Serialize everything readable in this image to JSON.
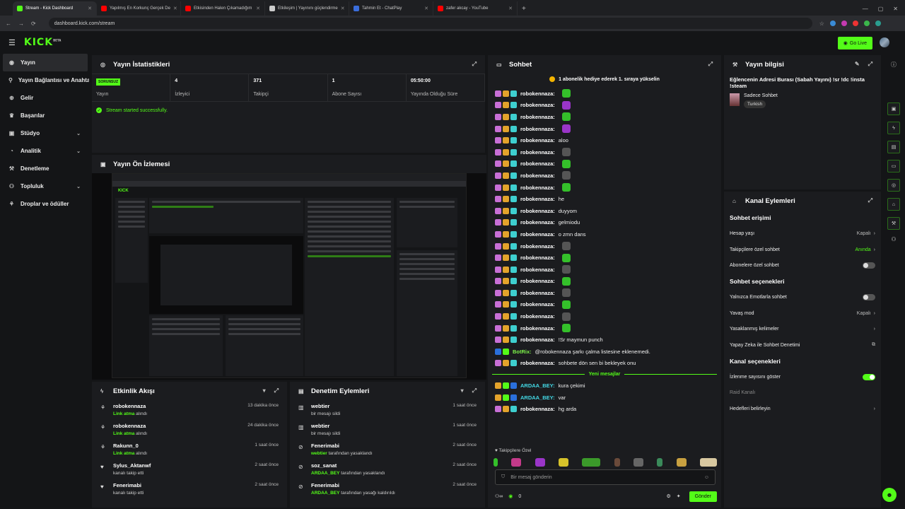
{
  "browser": {
    "tabs": [
      {
        "label": "Stream - Kick Dashboard",
        "color": "#53fc18"
      },
      {
        "label": "Yapılmış En Korkunç Gerçek De",
        "color": "#ff0000"
      },
      {
        "label": "Etkisinden Halen Çıkamadığım",
        "color": "#ff0000"
      },
      {
        "label": "Etkileşim | Yayınını güçlendirme",
        "color": "#cccccc"
      },
      {
        "label": "Tahmin Et - ChatPlay",
        "color": "#3a6ddb"
      },
      {
        "label": "zafer akcay - YouTube",
        "color": "#ff0000"
      }
    ],
    "url": "dashboard.kick.com/stream"
  },
  "header": {
    "logo": "KICK",
    "logo_sup": "BETA",
    "go_live": "Go Live"
  },
  "sidebar": {
    "items": [
      {
        "label": "Yayın",
        "icon": "broadcast-icon"
      },
      {
        "label": "Yayın Bağlantısı ve Anahtarı",
        "icon": "key-icon"
      },
      {
        "label": "Gelir",
        "icon": "money-icon"
      },
      {
        "label": "Başarılar",
        "icon": "trophy-icon"
      },
      {
        "label": "Stüdyo",
        "icon": "studio-icon"
      },
      {
        "label": "Analitik",
        "icon": "analytics-icon"
      },
      {
        "label": "Denetleme",
        "icon": "wrench-icon"
      },
      {
        "label": "Topluluk",
        "icon": "community-icon"
      },
      {
        "label": "Droplar ve ödüller",
        "icon": "gift-icon"
      }
    ]
  },
  "stats": {
    "title": "Yayın İstatistikleri",
    "badge": "SORUNSUZ",
    "items": [
      {
        "value": "",
        "label": "Yayın"
      },
      {
        "value": "4",
        "label": "İzleyici"
      },
      {
        "value": "371",
        "label": "Takipçi"
      },
      {
        "value": "1",
        "label": "Abone Sayısı"
      },
      {
        "value": "05:50:00",
        "label": "Yayında Olduğu Süre"
      }
    ],
    "success": "Stream started successfully."
  },
  "preview": {
    "title": "Yayın Ön İzlemesi"
  },
  "feed": {
    "title": "Etkinlik Akışı",
    "items": [
      {
        "name": "robokennaza",
        "hl": "Link atma",
        "rest": " alındı",
        "time": "13 dakika önce",
        "icon": "gift-icon"
      },
      {
        "name": "robokennaza",
        "hl": "Link atma",
        "rest": " alındı",
        "time": "24 dakika önce",
        "icon": "gift-icon"
      },
      {
        "name": "Rakunn_0",
        "hl": "Link atma",
        "rest": " alındı",
        "time": "1 saat önce",
        "icon": "gift-icon"
      },
      {
        "name": "Sylus_Aktanwf",
        "hl": "",
        "rest": "kanalı takip etti",
        "time": "2 saat önce",
        "icon": "heart-icon"
      },
      {
        "name": "Fenerimabi",
        "hl": "",
        "rest": "kanalı takip etti",
        "time": "2 saat önce",
        "icon": "heart-icon"
      }
    ]
  },
  "mod": {
    "title": "Denetim Eylemleri",
    "items": [
      {
        "name": "webtier",
        "hl": "",
        "rest": "bir mesajı sildi",
        "time": "1 saat önce",
        "icon": "trash-icon"
      },
      {
        "name": "webtier",
        "hl": "",
        "rest": "bir mesajı sildi",
        "time": "1 saat önce",
        "icon": "trash-icon"
      },
      {
        "name": "Fenerimabi",
        "hl": "webtier",
        "rest": " tarafından yasaklandı",
        "time": "2 saat önce",
        "icon": "ban-icon"
      },
      {
        "name": "soz_sanat",
        "hl": "ARDAA_BEY",
        "rest": " tarafından yasaklandı",
        "time": "2 saat önce",
        "icon": "ban-icon"
      },
      {
        "name": "Fenerimabi",
        "hl": "ARDAA_BEY",
        "rest": " tarafından yasağı kaldırıldı",
        "time": "2 saat önce",
        "icon": "ban-icon"
      }
    ]
  },
  "chat": {
    "title": "Sohbet",
    "notice": "1 abonelik hediye ederek 1. sıraya yükselin",
    "messages": [
      {
        "user": "robokennaza",
        "text": "",
        "emote": "e-g"
      },
      {
        "user": "robokennaza",
        "text": "",
        "emote": "e-p"
      },
      {
        "user": "robokennaza",
        "text": "",
        "emote": "e-g"
      },
      {
        "user": "robokennaza",
        "text": "",
        "emote": "e-p"
      },
      {
        "user": "robokennaza",
        "text": "aloo",
        "emote": ""
      },
      {
        "user": "robokennaza",
        "text": "",
        "emote": "e-k"
      },
      {
        "user": "robokennaza",
        "text": "",
        "emote": "e-g"
      },
      {
        "user": "robokennaza",
        "text": "",
        "emote": "e-k"
      },
      {
        "user": "robokennaza",
        "text": "",
        "emote": "e-g"
      },
      {
        "user": "robokennaza",
        "text": "he",
        "emote": ""
      },
      {
        "user": "robokennaza",
        "text": "duyyom",
        "emote": ""
      },
      {
        "user": "robokennaza",
        "text": "gelmiodu",
        "emote": ""
      },
      {
        "user": "robokennaza",
        "text": "o zmn dans",
        "emote": ""
      },
      {
        "user": "robokennaza",
        "text": "",
        "emote": "e-k"
      },
      {
        "user": "robokennaza",
        "text": "",
        "emote": "e-g"
      },
      {
        "user": "robokennaza",
        "text": "",
        "emote": "e-k"
      },
      {
        "user": "robokennaza",
        "text": "",
        "emote": "e-g"
      },
      {
        "user": "robokennaza",
        "text": "",
        "emote": "e-k"
      },
      {
        "user": "robokennaza",
        "text": "",
        "emote": "e-g"
      },
      {
        "user": "robokennaza",
        "text": "",
        "emote": "e-k"
      },
      {
        "user": "robokennaza",
        "text": "",
        "emote": "e-g"
      },
      {
        "user": "robokennaza",
        "text": "!Sr maymun punch",
        "emote": ""
      },
      {
        "user": "BotRix:",
        "text": "@robokennaza şarkı çalma listesine eklenemedi.",
        "emote": "",
        "bot": true
      },
      {
        "user": "robokennaza",
        "text": "sohbete dön sen bi bekleyek onu",
        "emote": ""
      }
    ],
    "new_label": "Yeni mesajlar",
    "new_messages": [
      {
        "user": "ARDAA_BEY",
        "text": "kura çekimi"
      },
      {
        "user": "ARDAA_BEY",
        "text": "var"
      },
      {
        "user": "robokennaza",
        "text": "hg arda"
      }
    ],
    "follow_only": "Takipçilere Özel",
    "placeholder": "Bir mesaj gönderin",
    "count": "0",
    "send": "Gönder"
  },
  "info": {
    "title": "Yayın bilgisi",
    "stream_title": "Eğlencenin Adresi Burası (Sabah Yayını) !sr !dc !insta !steam",
    "category": "Sadece Sohbet",
    "language": "Turkish"
  },
  "channel": {
    "title": "Kanal Eylemleri",
    "sec1": "Sohbet erişimi",
    "sec2": "Sohbet seçenekleri",
    "sec3": "Kanal seçenekleri",
    "hesap_yasi": "Hesap yaşı",
    "hesap_yasi_val": "Kapalı",
    "takipci": "Takipçilere özel sohbet",
    "takipci_val": "Anında",
    "abone": "Abonelere özel sohbet",
    "emote": "Yalnızca Emotlarla sohbet",
    "yavas": "Yavaş mod",
    "yavas_val": "Kapalı",
    "yasak": "Yasaklanmış kelimeler",
    "ai": "Yapay Zeka ile Sohbet Denetimi",
    "izlenme": "İzlenme sayısını göster",
    "raid": "Raid Kanalı",
    "hedef": "Hedefleri belirleyin"
  }
}
